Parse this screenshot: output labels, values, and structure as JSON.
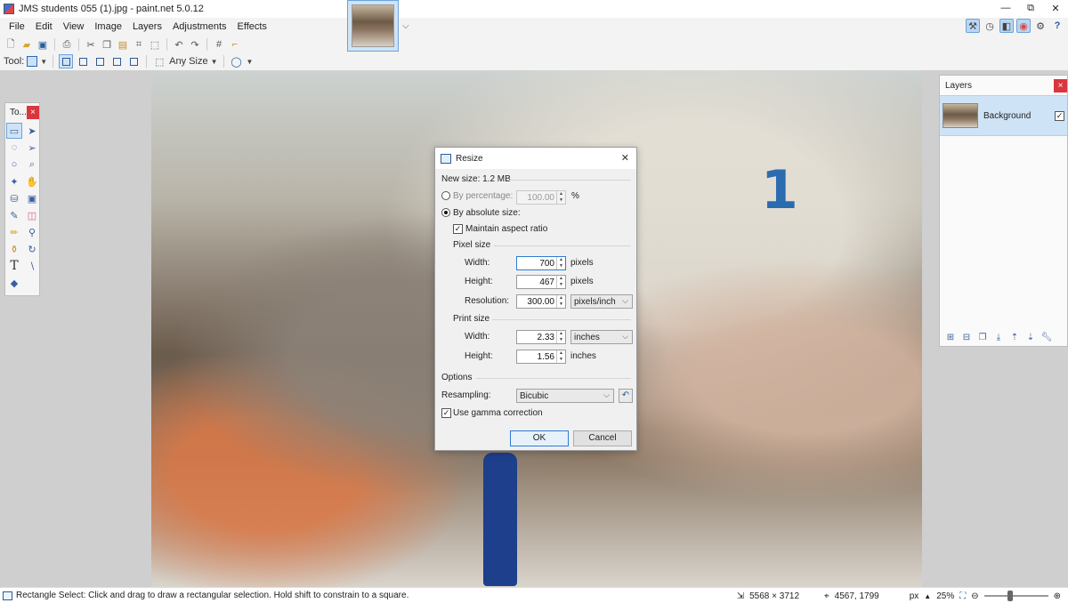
{
  "window": {
    "title": "JMS students 055 (1).jpg - paint.net 5.0.12",
    "min": "—",
    "max": "⧉",
    "close": "✕"
  },
  "menu": [
    "File",
    "Edit",
    "View",
    "Image",
    "Layers",
    "Adjustments",
    "Effects"
  ],
  "toolbar": {
    "tool_label": "Tool:",
    "size_label": "Any Size"
  },
  "tools_window": {
    "title": "To...",
    "close": "×"
  },
  "layers_window": {
    "title": "Layers",
    "close": "×",
    "layer_name": "Background",
    "visible_check": "✓"
  },
  "dialog": {
    "title": "Resize",
    "close": "✕",
    "new_size": "New size: 1.2 MB",
    "by_percentage": "By percentage:",
    "percentage_value": "100.00",
    "percentage_unit": "%",
    "by_absolute": "By absolute size:",
    "maintain_aspect": "Maintain aspect ratio",
    "pixel_size_heading": "Pixel size",
    "width_label": "Width:",
    "height_label": "Height:",
    "resolution_label": "Resolution:",
    "pixel_width": "700",
    "pixel_height": "467",
    "pixels_unit": "pixels",
    "resolution_value": "300.00",
    "resolution_unit": "pixels/inch",
    "print_size_heading": "Print size",
    "print_width": "2.33",
    "print_height": "1.56",
    "inches_unit": "inches",
    "options_heading": "Options",
    "resampling_label": "Resampling:",
    "resampling_value": "Bicubic",
    "gamma_label": "Use gamma correction",
    "check": "✓",
    "ok_label": "OK",
    "cancel_label": "Cancel"
  },
  "statusbar": {
    "hint": "Rectangle Select: Click and drag to draw a rectangular selection. Hold shift to constrain to a square.",
    "image_size": "5568 × 3712",
    "cursor_pos": "4567, 1799",
    "unit": "px",
    "zoom": "25%",
    "zoom_level": 0.25
  },
  "photo": {
    "banner_number": "1"
  }
}
